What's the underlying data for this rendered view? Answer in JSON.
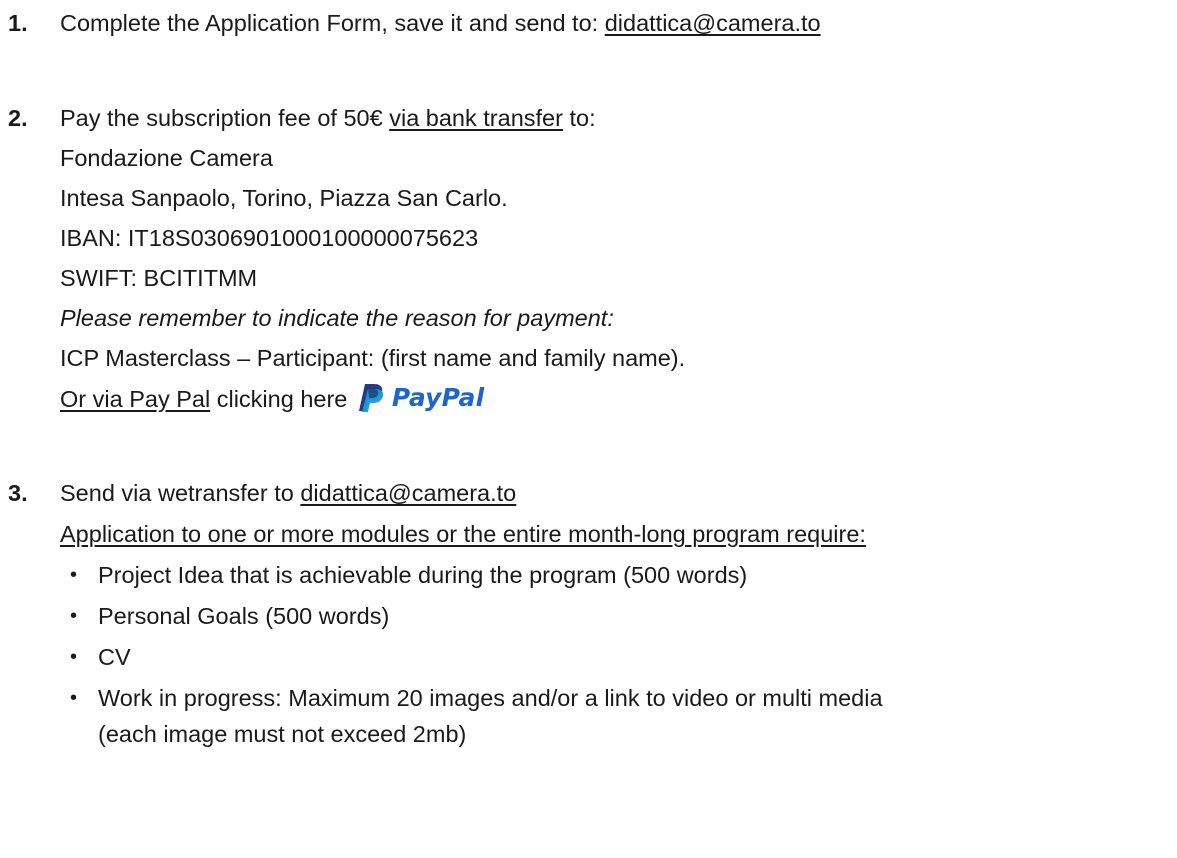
{
  "step1": {
    "number": "1.",
    "text": "Complete the Application Form, save it and send to: ",
    "email": "didattica@camera.to"
  },
  "step2": {
    "number": "2.",
    "text_before": "Pay the subscription fee of 50€ ",
    "bank_link": "via bank transfer",
    "text_after": " to:",
    "recipient": "Fondazione Camera",
    "bank": "Intesa Sanpaolo, Torino, Piazza San Carlo.",
    "iban": "IBAN: IT18S0306901000100000075623",
    "swift": "SWIFT: BCITITMM",
    "reminder": "Please remember to indicate the reason for payment:",
    "reason": "ICP Masterclass – Participant: (first name and family name).",
    "paypal_link": "Or via Pay Pal",
    "paypal_suffix": " clicking here ",
    "paypal_logo_text": "PayPal",
    "paypal_color": "#1f66c7"
  },
  "step3": {
    "number": "3.",
    "text": "Send via wetransfer to ",
    "email": "didattica@camera.to",
    "requirements_heading": "Application to one or more modules or the entire month-long program require:",
    "bullet_glyph": "•",
    "items": [
      "Project Idea that is achievable during the program (500 words)",
      "Personal Goals (500 words)",
      "CV",
      "Work in progress: Maximum 20 images and/or a link to video or multi media"
    ],
    "item4_continued": "(each image must not exceed 2mb)"
  }
}
